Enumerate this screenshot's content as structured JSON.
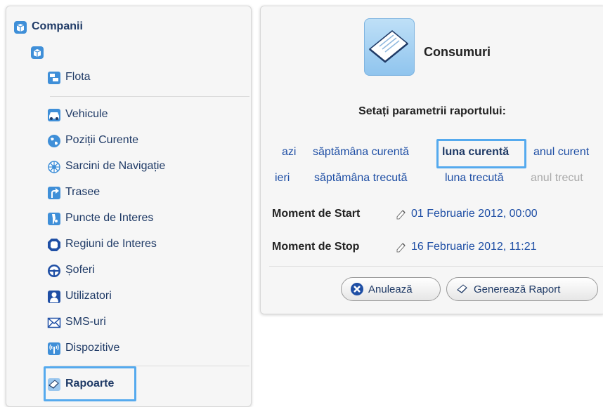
{
  "sidebar": {
    "root_label": "Companii",
    "items": [
      {
        "label": "Flota",
        "icon": "fleet-icon"
      },
      {
        "label": "Vehicule",
        "icon": "car-icon"
      },
      {
        "label": "Poziții Curente",
        "icon": "globe-icon"
      },
      {
        "label": "Sarcini de Navigație",
        "icon": "compass-icon"
      },
      {
        "label": "Trasee",
        "icon": "route-arrow-icon"
      },
      {
        "label": "Puncte de Interes",
        "icon": "poi-pin-icon"
      },
      {
        "label": "Regiuni de Interes",
        "icon": "region-octagon-icon"
      },
      {
        "label": "Șoferi",
        "icon": "steering-wheel-icon"
      },
      {
        "label": "Utilizatori",
        "icon": "user-icon"
      },
      {
        "label": "SMS-uri",
        "icon": "envelope-icon"
      },
      {
        "label": "Dispozitive",
        "icon": "antenna-icon"
      },
      {
        "label": "Rapoarte",
        "icon": "report-pen-icon"
      }
    ],
    "selected_item": "Rapoarte"
  },
  "report": {
    "title": "Consumuri",
    "subtitle": "Setați parametrii raportului:",
    "periods_row1": [
      "azi",
      "săptămâna curentă",
      "luna curentă",
      "anul curent"
    ],
    "periods_row2": [
      "ieri",
      "săptămâna trecută",
      "luna trecută",
      "anul trecut"
    ],
    "selected_period": "luna curentă",
    "start_label": "Moment de Start",
    "start_value": "01 Februarie 2012, 00:00",
    "stop_label": "Moment de Stop",
    "stop_value": "16 Februarie 2012, 11:21",
    "cancel_label": "Anulează",
    "generate_label": "Generează Raport"
  },
  "colors": {
    "accent": "#55aaee",
    "link": "#1f4fa5",
    "disabled": "#aaaaaa"
  }
}
